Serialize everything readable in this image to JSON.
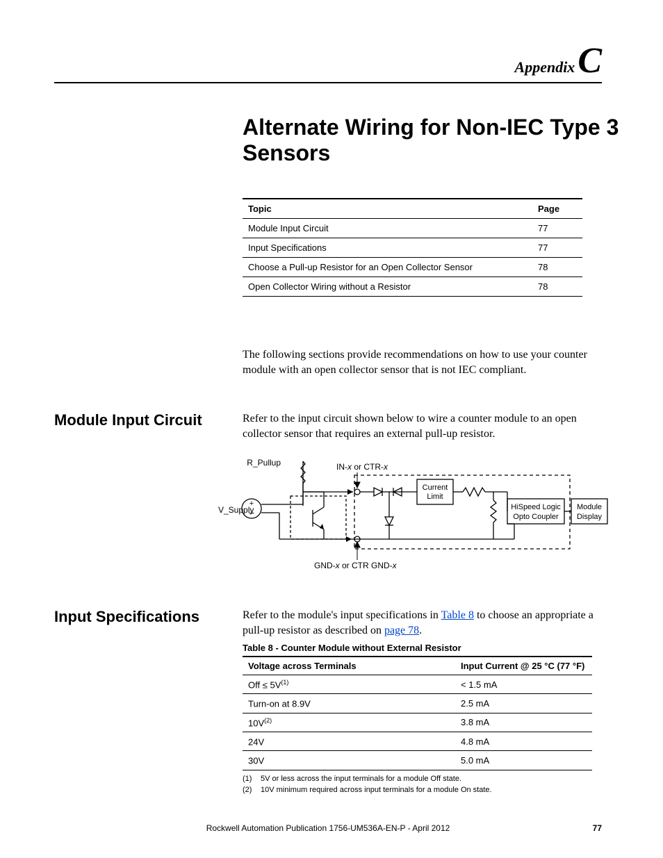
{
  "header": {
    "appendix_word": "Appendix",
    "appendix_letter": "C"
  },
  "title": "Alternate Wiring for Non-IEC Type 3 Sensors",
  "toc": {
    "headers": [
      "Topic",
      "Page"
    ],
    "rows": [
      {
        "topic": "Module Input Circuit",
        "page": "77"
      },
      {
        "topic": "Input Specifications",
        "page": "77"
      },
      {
        "topic": "Choose a Pull-up Resistor for an Open Collector Sensor",
        "page": "78"
      },
      {
        "topic": "Open Collector Wiring without a Resistor",
        "page": "78"
      }
    ]
  },
  "intro": "The following sections provide recommendations on how to use your counter module with an open collector sensor that is not IEC compliant.",
  "section1": {
    "heading": "Module Input Circuit",
    "body": "Refer to the input circuit shown below to wire a counter module to an open collector sensor that requires an external pull-up resistor."
  },
  "circuit": {
    "labels": {
      "r_pullup": "R_Pullup",
      "in_x": "IN-",
      "in_x_suffix": " or CTR-",
      "x_italic": "x",
      "current_limit_1": "Current",
      "current_limit_2": "Limit",
      "v_supply": "V_Supply",
      "hispeed_1": "HiSpeed Logic",
      "hispeed_2": "Opto Coupler",
      "module_display_1": "Module",
      "module_display_2": "Display",
      "gnd": "GND-",
      "gnd_suffix": " or CTR GND-"
    }
  },
  "section2": {
    "heading": "Input Specifications",
    "body_pre": "Refer to the module's input specifications in ",
    "link1": "Table 8",
    "body_mid": " to choose an appropriate a pull-up resistor as described on ",
    "link2": "page 78",
    "body_post": "."
  },
  "table8": {
    "caption": "Table 8 - Counter Module without External Resistor",
    "headers": [
      "Voltage across Terminals",
      "Input Current @ 25 °C (77 °F)"
    ],
    "rows": [
      {
        "v_pre": "Off ≤ 5V",
        "v_sup": "(1)",
        "i": "< 1.5 mA"
      },
      {
        "v_pre": "Turn-on at 8.9V",
        "v_sup": "",
        "i": "2.5 mA"
      },
      {
        "v_pre": "10V",
        "v_sup": "(2)",
        "i": "3.8 mA"
      },
      {
        "v_pre": "24V",
        "v_sup": "",
        "i": "4.8 mA"
      },
      {
        "v_pre": "30V",
        "v_sup": "",
        "i": "5.0 mA"
      }
    ]
  },
  "footnotes": [
    {
      "num": "(1)",
      "text": "5V or less across the input terminals for a module Off state."
    },
    {
      "num": "(2)",
      "text": "10V minimum required across input terminals for a module On state."
    }
  ],
  "footer": {
    "publication": "Rockwell Automation Publication 1756-UM536A-EN-P - April 2012",
    "page_number": "77"
  }
}
